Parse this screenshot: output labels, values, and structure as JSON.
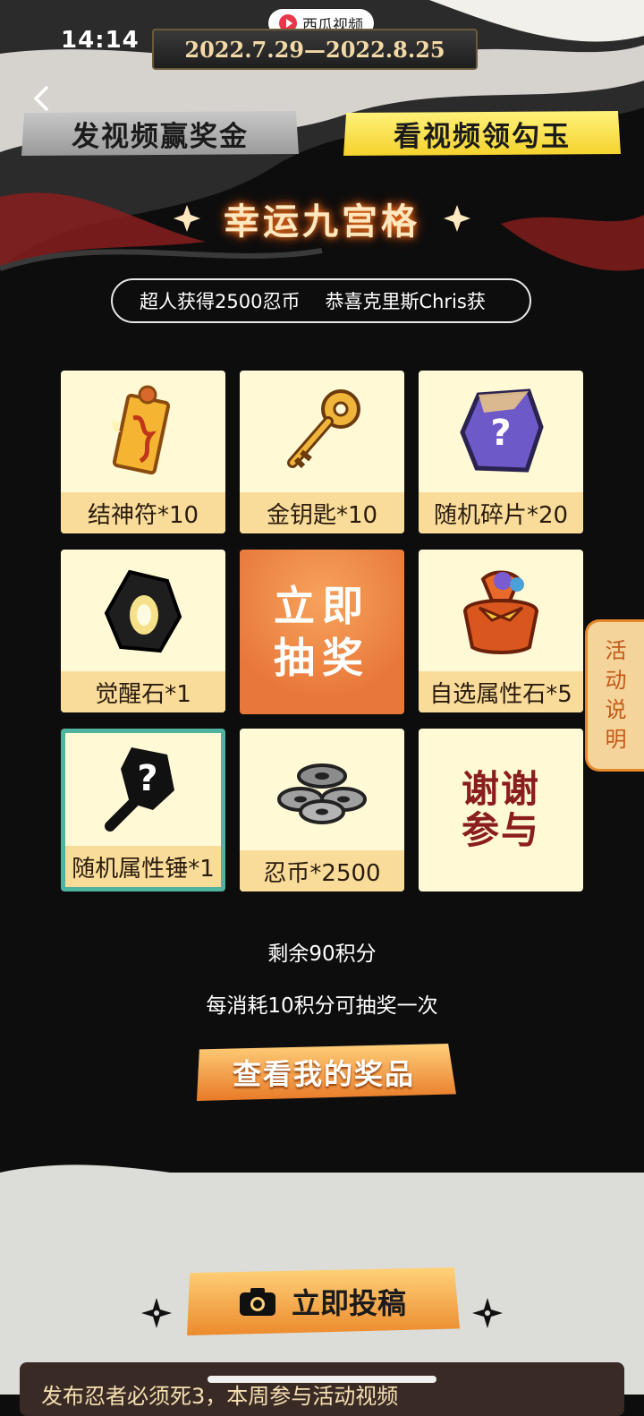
{
  "status_bar": {
    "time": "14:14"
  },
  "app_pill": {
    "label": "西瓜视频"
  },
  "header": {
    "date_range": "2022.7.29—2022.8.25"
  },
  "tabs": [
    {
      "label": "发视频赢奖金",
      "active": false
    },
    {
      "label": "看视频领勾玉",
      "active": true
    }
  ],
  "section": {
    "title": "幸运九宫格"
  },
  "ticker": {
    "messages": [
      "超人获得2500忍币",
      "恭喜克里斯Chris获"
    ]
  },
  "grid": {
    "cells": [
      {
        "label": "结神符*10",
        "icon": "talisman-icon"
      },
      {
        "label": "金钥匙*10",
        "icon": "key-icon"
      },
      {
        "label": "随机碎片*20",
        "icon": "mystery-fragment-icon"
      },
      {
        "label": "觉醒石*1",
        "icon": "awakening-stone-icon"
      },
      {
        "label": "自选属性石*5",
        "icon": "gift-bag-icon"
      },
      {
        "label": "随机属性锤*1",
        "icon": "mystery-hammer-icon",
        "selected": true
      },
      {
        "label": "忍币*2500",
        "icon": "coins-icon"
      }
    ],
    "draw_button": {
      "line1": "立即",
      "line2": "抽奖"
    },
    "thanks": {
      "line1": "谢谢",
      "line2": "参与"
    }
  },
  "side_tab": {
    "label_lines": [
      "活",
      "动",
      "说",
      "明"
    ]
  },
  "points": {
    "remaining": "剩余90积分",
    "rule": "每消耗10积分可抽奖一次"
  },
  "buttons": {
    "my_prizes": "查看我的奖品",
    "submit": "立即投稿"
  },
  "footer": {
    "text": "发布忍者必须死3，本周参与活动视频"
  },
  "colors": {
    "accent_orange": "#e8783a",
    "cell_bg": "#fff9d6",
    "label_bg": "#f9dc9a",
    "selected_border": "#4fb3a0",
    "tab_active": "#f5d22d"
  }
}
